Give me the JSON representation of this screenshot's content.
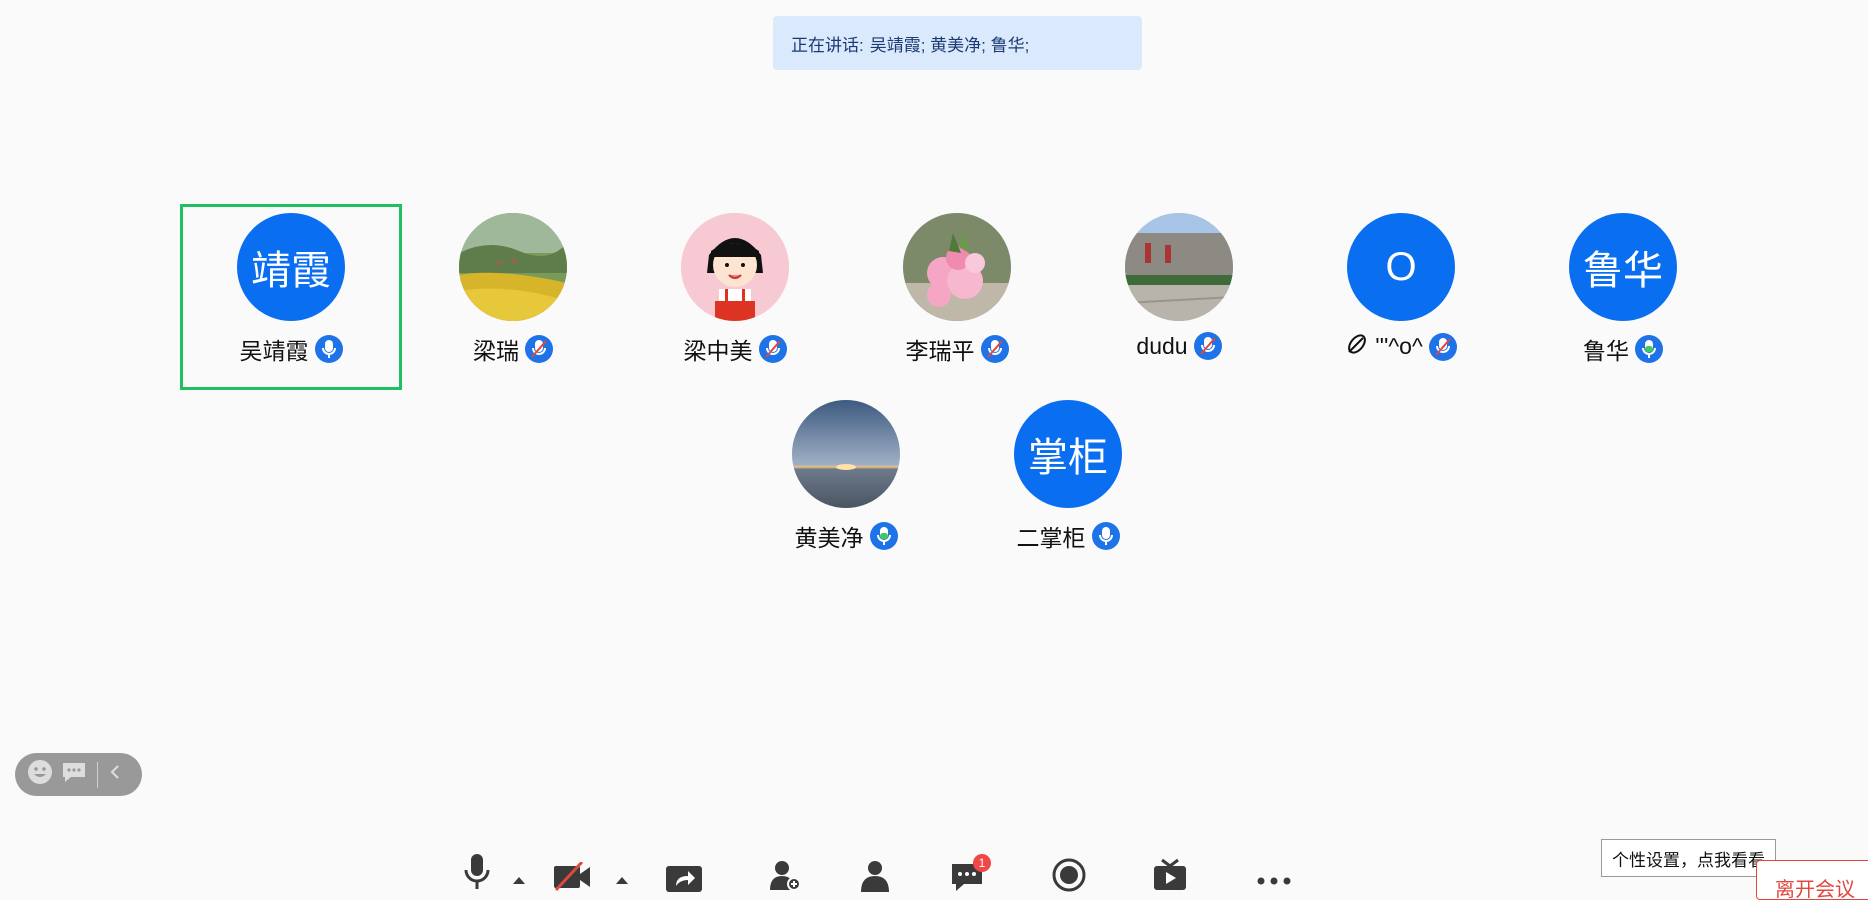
{
  "speaking": {
    "label": "正在讲话:",
    "names": "吴靖霞; 黄美净; 鲁华;"
  },
  "participants": [
    {
      "name": "吴靖霞",
      "avatar_text": "靖霞",
      "mic": "on",
      "active": true
    },
    {
      "name": "梁瑞",
      "avatar_text": "",
      "mic": "muted"
    },
    {
      "name": "梁中美",
      "avatar_text": "",
      "mic": "muted"
    },
    {
      "name": "李瑞平",
      "avatar_text": "",
      "mic": "muted"
    },
    {
      "name": "dudu",
      "avatar_text": "",
      "mic": "muted"
    },
    {
      "name": "'''^o^",
      "avatar_text": "O",
      "mic": "muted"
    },
    {
      "name": "鲁华",
      "avatar_text": "鲁华",
      "mic": "speaking"
    },
    {
      "name": "黄美净",
      "avatar_text": "",
      "mic": "speaking"
    },
    {
      "name": "二掌柜",
      "avatar_text": "掌柜",
      "mic": "on"
    }
  ],
  "toolbar": {
    "chat_badge": "1"
  },
  "tooltip": "个性设置，点我看看",
  "leave_button": "离开会议",
  "colors": {
    "accent": "#0a6ef0",
    "active_border": "#1fbf64",
    "speaking_mic": "#3ec95a",
    "leave": "#e0483e"
  }
}
